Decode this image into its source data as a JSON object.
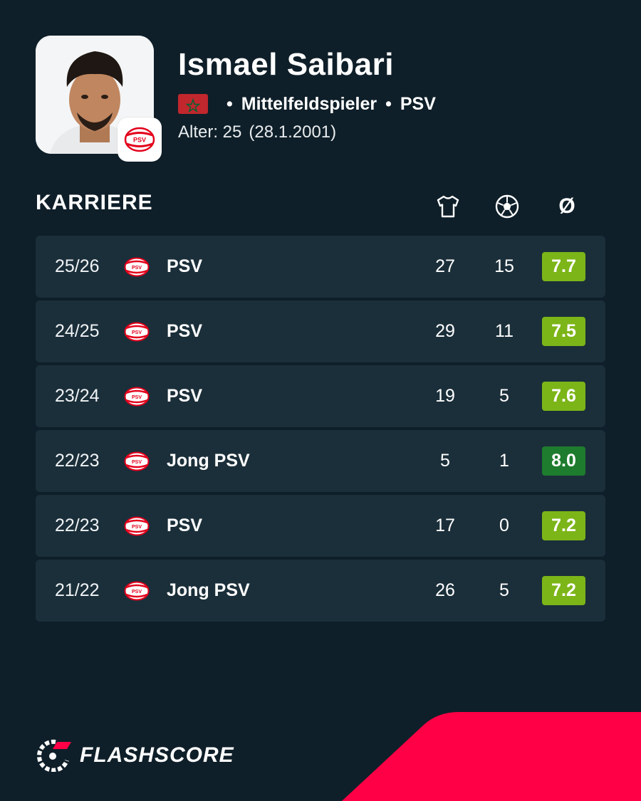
{
  "player": {
    "name": "Ismael Saibari",
    "position": "Mittelfeldspieler",
    "club": "PSV",
    "age_label": "Alter: 25",
    "birthdate": "(28.1.2001)",
    "country_flag": "morocco-flag"
  },
  "career": {
    "title": "KARRIERE",
    "columns": {
      "appearances_icon": "shirt-icon",
      "goals_icon": "football-icon",
      "average_label": "Ø"
    },
    "rows": [
      {
        "season": "25/26",
        "team": "PSV",
        "apps": "27",
        "goals": "15",
        "rating": "7.7",
        "rating_color": "#7cb518"
      },
      {
        "season": "24/25",
        "team": "PSV",
        "apps": "29",
        "goals": "11",
        "rating": "7.5",
        "rating_color": "#7cb518"
      },
      {
        "season": "23/24",
        "team": "PSV",
        "apps": "19",
        "goals": "5",
        "rating": "7.6",
        "rating_color": "#7cb518"
      },
      {
        "season": "22/23",
        "team": "Jong PSV",
        "apps": "5",
        "goals": "1",
        "rating": "8.0",
        "rating_color": "#1e7c2e"
      },
      {
        "season": "22/23",
        "team": "PSV",
        "apps": "17",
        "goals": "0",
        "rating": "7.2",
        "rating_color": "#7cb518"
      },
      {
        "season": "21/22",
        "team": "Jong PSV",
        "apps": "26",
        "goals": "5",
        "rating": "7.2",
        "rating_color": "#7cb518"
      }
    ]
  },
  "brand": {
    "name": "FLASHSCORE",
    "accent": "#ff0046"
  },
  "colors": {
    "background": "#0f1f29",
    "row_background": "#1b2f3a"
  }
}
